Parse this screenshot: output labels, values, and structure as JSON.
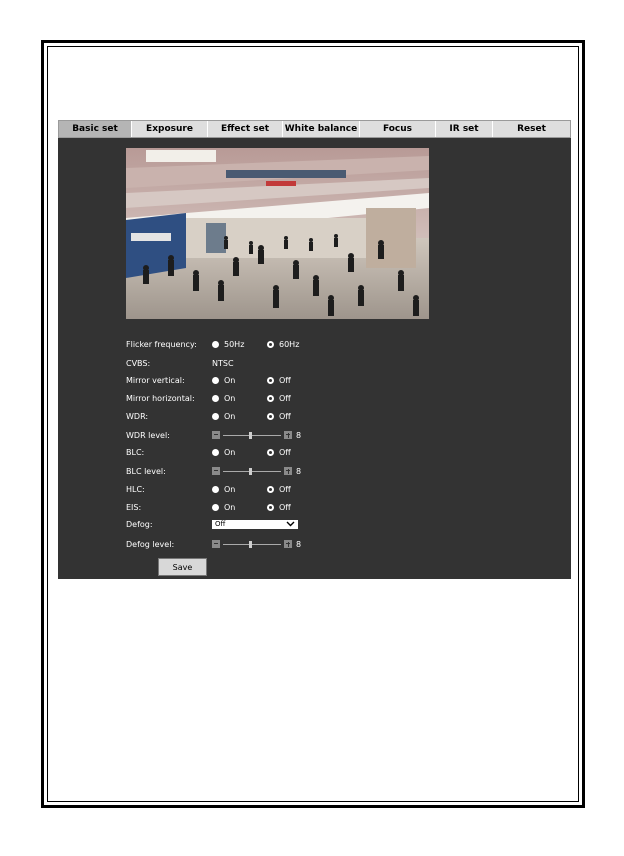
{
  "tabs": [
    {
      "label": "Basic set",
      "active": true
    },
    {
      "label": "Exposure",
      "active": false
    },
    {
      "label": "Effect set",
      "active": false
    },
    {
      "label": "White balance",
      "active": false
    },
    {
      "label": "Focus",
      "active": false
    },
    {
      "label": "IR set",
      "active": false
    },
    {
      "label": "Reset",
      "active": false
    }
  ],
  "settings": {
    "flicker": {
      "label": "Flicker frequency:",
      "opt1": "50Hz",
      "opt2": "60Hz",
      "selected": "60Hz"
    },
    "cvbs": {
      "label": "CVBS:",
      "value": "NTSC"
    },
    "mirror_vertical": {
      "label": "Mirror vertical:",
      "on": "On",
      "off": "Off",
      "selected": "Off"
    },
    "mirror_horizontal": {
      "label": "Mirror horizontal:",
      "on": "On",
      "off": "Off",
      "selected": "Off"
    },
    "wdr": {
      "label": "WDR:",
      "on": "On",
      "off": "Off",
      "selected": "Off"
    },
    "wdr_level": {
      "label": "WDR level:",
      "value": "8"
    },
    "blc": {
      "label": "BLC:",
      "on": "On",
      "off": "Off",
      "selected": "Off"
    },
    "blc_level": {
      "label": "BLC level:",
      "value": "8"
    },
    "hlc": {
      "label": "HLC:",
      "on": "On",
      "off": "Off",
      "selected": "Off"
    },
    "eis": {
      "label": "EIS:",
      "on": "On",
      "off": "Off",
      "selected": "Off"
    },
    "defog": {
      "label": "Defog:",
      "value": "Off"
    },
    "defog_level": {
      "label": "Defog level:",
      "value": "8"
    }
  },
  "save_label": "Save",
  "icons": {
    "select_arrow": "chevron-down-icon",
    "minus": "minus-icon",
    "plus": "plus-icon"
  },
  "colors": {
    "panel": "#333333",
    "tab_bar": "#dedede",
    "tab_active": "#b5b5b5"
  }
}
